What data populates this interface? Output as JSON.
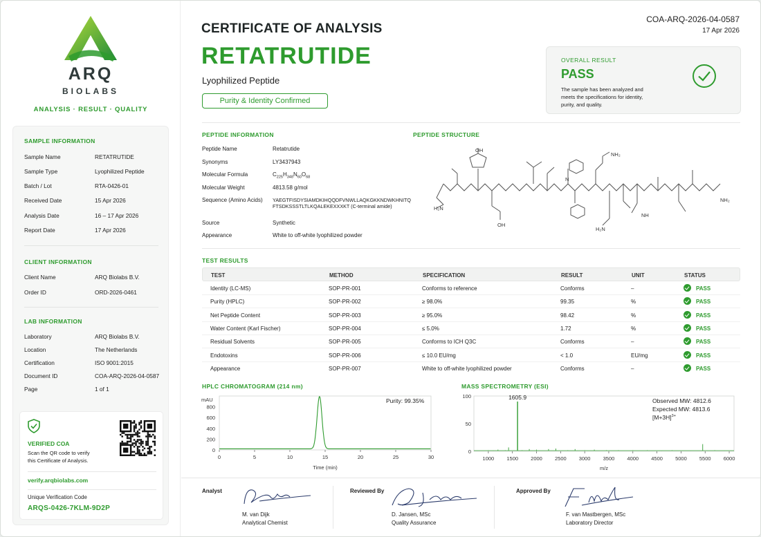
{
  "brand": {
    "name": "ARQ",
    "sub": "BIOLABS",
    "tagline": "ANALYSIS · RESULT · QUALITY"
  },
  "sample": {
    "heading": "SAMPLE INFORMATION",
    "rows": [
      {
        "k": "Sample Name",
        "v": "RETATRUTIDE"
      },
      {
        "k": "Sample Type",
        "v": "Lyophilized Peptide"
      },
      {
        "k": "Batch / Lot",
        "v": "RTA-0426-01"
      },
      {
        "k": "Received Date",
        "v": "15  Apr  2026"
      },
      {
        "k": "Analysis Date",
        "v": "16 – 17  Apr  2026"
      },
      {
        "k": "Report Date",
        "v": "17  Apr  2026"
      }
    ]
  },
  "client": {
    "heading": "CLIENT INFORMATION",
    "rows": [
      {
        "k": "Client Name",
        "v": "ARQ Biolabs B.V."
      },
      {
        "k": "Order ID",
        "v": "ORD-2026-0461"
      }
    ]
  },
  "lab": {
    "heading": "LAB INFORMATION",
    "rows": [
      {
        "k": "Laboratory",
        "v": "ARQ Biolabs B.V."
      },
      {
        "k": "Location",
        "v": "The Netherlands"
      },
      {
        "k": "Certification",
        "v": "ISO 9001:2015"
      },
      {
        "k": "Document ID",
        "v": "COA-ARQ-2026-04-0587"
      },
      {
        "k": "Page",
        "v": "1 of 1"
      }
    ]
  },
  "verify": {
    "title": "VERIFIED COA",
    "text1": "Scan the QR code to verify",
    "text2": "this Certificate of Analysis.",
    "url": "verify.arqbiolabs.com",
    "code_label": "Unique Verification Code",
    "code": "ARQS-0426-7KLM-9D2P"
  },
  "header": {
    "title": "CERTIFICATE OF ANALYSIS",
    "product": "RETATRUTIDE",
    "type": "Lyophilized Peptide",
    "badge": "Purity & Identity Confirmed",
    "doc_id": "COA-ARQ-2026-04-0587",
    "date": "17 Apr 2026"
  },
  "overall": {
    "label": "OVERALL RESULT",
    "result": "PASS",
    "line1": "The sample has been analyzed and",
    "line2": "meets the specifications for identity,",
    "line3": "purity, and quality."
  },
  "peptide": {
    "heading": "PEPTIDE INFORMATION",
    "structure_heading": "PEPTIDE STRUCTURE",
    "name_k": "Peptide Name",
    "name": "Retatrutide",
    "syn_k": "Synonyms",
    "syn": "LY3437943",
    "formula_k": "Molecular Formula",
    "f_c": "C",
    "f_c_n": "225",
    "f_h": "H",
    "f_h_n": "348",
    "f_n": "N",
    "f_n_n": "60",
    "f_o": "O",
    "f_o_n": "68",
    "mw_k": "Molecular Weight",
    "mw": "4813.58 g/mol",
    "seq_k": "Sequence (Amino Acids)",
    "seq1": "YAEGTFISDYSIAMDKIHQQDFVNWLLAQKGKKNDWKHNITQ",
    "seq2": "FTSDKSSSTLTLKQALEKEXXXKT (C-terminal amide)",
    "source_k": "Source",
    "source": "Synthetic",
    "appear_k": "Appearance",
    "appear": "White to off-white lyophilized powder"
  },
  "structure_labels": {
    "oh1": "OH",
    "nh2a": "NH₂",
    "h2n": "H₂N",
    "oh2": "OH",
    "h2n2": "H₂N",
    "nh2b": "NH₂",
    "n": "N",
    "nh": "NH"
  },
  "tests": {
    "heading": "TEST RESULTS",
    "columns": [
      "TEST",
      "METHOD",
      "SPECIFICATION",
      "RESULT",
      "UNIT",
      "STATUS"
    ],
    "rows": [
      {
        "test": "Identity (LC-MS)",
        "method": "SOP-PR-001",
        "spec": "Conforms to reference",
        "result": "Conforms",
        "unit": "–",
        "status": "PASS"
      },
      {
        "test": "Purity (HPLC)",
        "method": "SOP-PR-002",
        "spec": "≥ 98.0%",
        "result": "99.35",
        "unit": "%",
        "status": "PASS"
      },
      {
        "test": "Net Peptide Content",
        "method": "SOP-PR-003",
        "spec": "≥ 95.0%",
        "result": "98.42",
        "unit": "%",
        "status": "PASS"
      },
      {
        "test": "Water Content (Karl Fischer)",
        "method": "SOP-PR-004",
        "spec": "≤ 5.0%",
        "result": "1.72",
        "unit": "%",
        "status": "PASS"
      },
      {
        "test": "Residual Solvents",
        "method": "SOP-PR-005",
        "spec": "Conforms to ICH Q3C",
        "result": "Conforms",
        "unit": "–",
        "status": "PASS"
      },
      {
        "test": "Endotoxins",
        "method": "SOP-PR-006",
        "spec": "≤ 10.0 EU/mg",
        "result": "< 1.0",
        "unit": "EU/mg",
        "status": "PASS"
      },
      {
        "test": "Appearance",
        "method": "SOP-PR-007",
        "spec": "White to off-white lyophilized powder",
        "result": "Conforms",
        "unit": "–",
        "status": "PASS"
      }
    ]
  },
  "hplc": {
    "heading": "HPLC CHROMATOGRAM (214 nm)",
    "purity_label": "Purity: 99.35%"
  },
  "ms": {
    "heading": "MASS SPECTROMETRY (ESI)",
    "obs": "Observed MW:  4812.6",
    "exp": "Expected MW:  4813.6",
    "ion": "[M+3H]",
    "ion_sup": "3+"
  },
  "chart_data": [
    {
      "type": "line",
      "title": "HPLC CHROMATOGRAM (214 nm)",
      "xlabel": "Time (min)",
      "ylabel": "mAU",
      "xlim": [
        0,
        30
      ],
      "ylim": [
        0,
        1000
      ],
      "xticks": [
        0,
        5,
        10,
        15,
        20,
        25,
        30
      ],
      "yticks": [
        0,
        200,
        400,
        600,
        800,
        1000
      ],
      "baseline": 20,
      "peak": {
        "x": 14.2,
        "y": 970,
        "width": 0.35
      },
      "annotation": "Purity: 99.35%"
    },
    {
      "type": "bar",
      "title": "MASS SPECTROMETRY (ESI)",
      "xlabel": "m/z",
      "xlim": [
        700,
        6100
      ],
      "ylim": [
        0,
        100
      ],
      "xticks": [
        1000,
        1500,
        2000,
        2500,
        3000,
        3500,
        4000,
        4500,
        5000,
        5500,
        6000
      ],
      "yticks": [
        0,
        50,
        100
      ],
      "peak_label": "1605.9",
      "peaks": [
        {
          "x": 1000,
          "y": 2
        },
        {
          "x": 1100,
          "y": 1
        },
        {
          "x": 1200,
          "y": 3
        },
        {
          "x": 1350,
          "y": 2
        },
        {
          "x": 1420,
          "y": 7
        },
        {
          "x": 1605.9,
          "y": 90
        },
        {
          "x": 1700,
          "y": 2
        },
        {
          "x": 1850,
          "y": 4
        },
        {
          "x": 2000,
          "y": 3
        },
        {
          "x": 2250,
          "y": 4
        },
        {
          "x": 2400,
          "y": 5
        },
        {
          "x": 2650,
          "y": 2
        },
        {
          "x": 2800,
          "y": 4
        },
        {
          "x": 3000,
          "y": 2
        },
        {
          "x": 3200,
          "y": 3
        },
        {
          "x": 3450,
          "y": 2
        },
        {
          "x": 3700,
          "y": 2
        },
        {
          "x": 4000,
          "y": 2
        },
        {
          "x": 4300,
          "y": 2
        },
        {
          "x": 4600,
          "y": 1
        },
        {
          "x": 4812.6,
          "y": 2
        },
        {
          "x": 5200,
          "y": 1
        },
        {
          "x": 5450,
          "y": 13
        },
        {
          "x": 5700,
          "y": 2
        },
        {
          "x": 5900,
          "y": 1
        }
      ]
    }
  ],
  "signatures": [
    {
      "role": "Analyst",
      "name": "M. van Dijk",
      "title": "Analytical Chemist"
    },
    {
      "role": "Reviewed By",
      "name": "D. Jansen, MSc",
      "title": "Quality Assurance"
    },
    {
      "role": "Approved By",
      "name": "F. van Mastbergen, MSc",
      "title": "Laboratory Director"
    }
  ],
  "colors": {
    "accent": "#2e9b2e"
  }
}
